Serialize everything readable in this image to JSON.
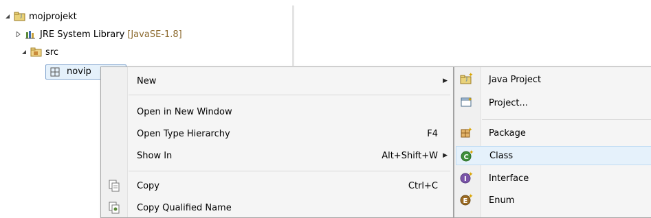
{
  "tree": {
    "project": {
      "name": "mojprojekt"
    },
    "jre": {
      "name": "JRE System Library",
      "decoration": "[JavaSE-1.8]"
    },
    "src": {
      "name": "src"
    },
    "package": {
      "name": "novip"
    }
  },
  "context_menu": {
    "items": [
      {
        "label": "New",
        "accel": "",
        "submenu": true
      },
      {
        "label": "Open in New Window",
        "accel": ""
      },
      {
        "label": "Open Type Hierarchy",
        "accel": "F4"
      },
      {
        "label": "Show In",
        "accel": "Alt+Shift+W",
        "submenu": true
      },
      {
        "label": "Copy",
        "accel": "Ctrl+C",
        "icon": "copy-icon"
      },
      {
        "label": "Copy Qualified Name",
        "accel": "",
        "icon": "copy-qualified-name-icon"
      }
    ]
  },
  "submenu": {
    "items": [
      {
        "label": "Java Project",
        "icon": "java-project-icon"
      },
      {
        "label": "Project...",
        "icon": "project-icon"
      },
      {
        "label": "Package",
        "icon": "package-icon"
      },
      {
        "label": "Class",
        "icon": "class-icon",
        "highlighted": true
      },
      {
        "label": "Interface",
        "icon": "interface-icon"
      },
      {
        "label": "Enum",
        "icon": "enum-icon"
      }
    ]
  },
  "colors": {
    "highlight": "#e5f1fb",
    "menu_bg": "#f5f5f5",
    "decoration": "#8c6a2f"
  }
}
